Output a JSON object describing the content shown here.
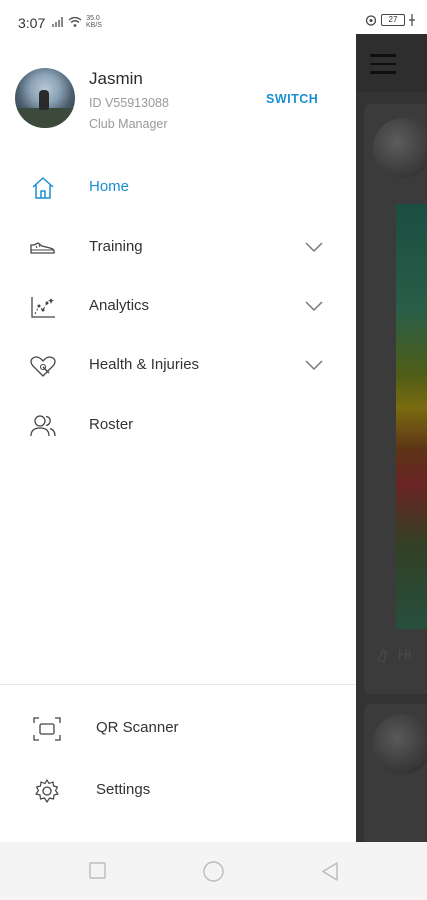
{
  "status_bar": {
    "time": "3:07",
    "net_speed_top": "35.0",
    "net_speed_bottom": "KB/S",
    "battery": "27"
  },
  "profile": {
    "name": "Jasmin",
    "id": "ID V55913088",
    "role": "Club Manager",
    "switch_label": "SWITCH"
  },
  "menu": {
    "items": [
      {
        "label": "Home",
        "icon": "home-icon",
        "active": true,
        "expandable": false
      },
      {
        "label": "Training",
        "icon": "shoe-icon",
        "active": false,
        "expandable": true
      },
      {
        "label": "Analytics",
        "icon": "analytics-icon",
        "active": false,
        "expandable": true
      },
      {
        "label": "Health & Injuries",
        "icon": "heart-health-icon",
        "active": false,
        "expandable": true
      },
      {
        "label": "Roster",
        "icon": "people-icon",
        "active": false,
        "expandable": false
      }
    ],
    "bottom_items": [
      {
        "label": "QR Scanner",
        "icon": "qr-scan-icon"
      },
      {
        "label": "Settings",
        "icon": "gear-icon"
      }
    ]
  },
  "background_app": {
    "peek_text": "Hi"
  },
  "colors": {
    "accent": "#1b8fd1",
    "text": "#333333",
    "muted": "#999999",
    "overlay": "#3b3b3b"
  }
}
